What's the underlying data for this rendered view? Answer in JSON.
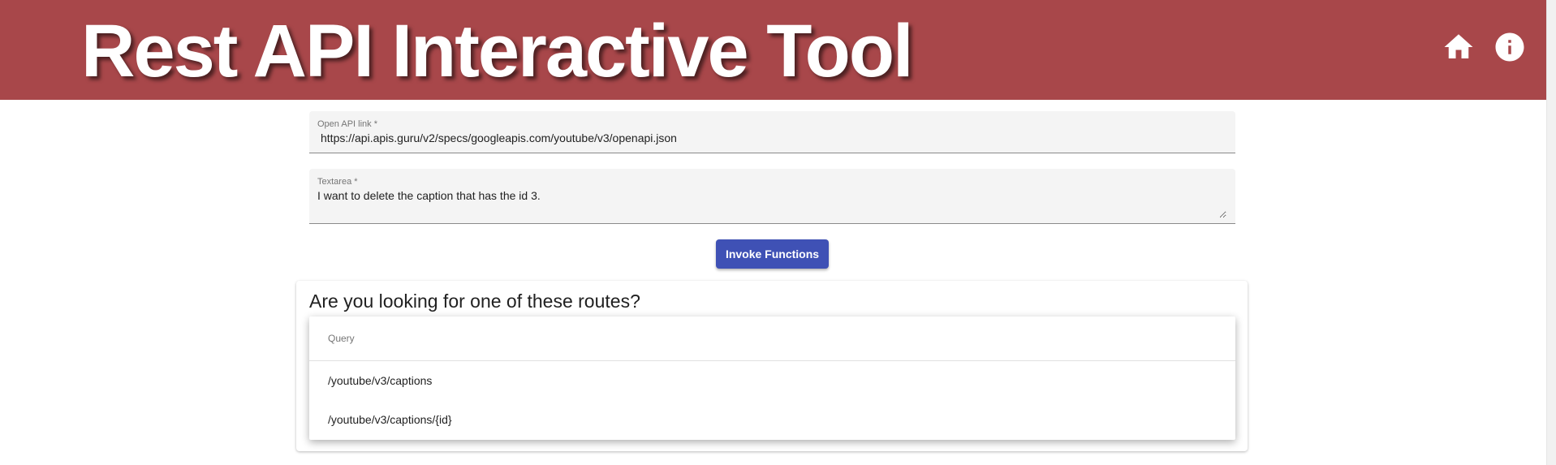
{
  "header": {
    "title": "Rest API Interactive Tool",
    "icons": [
      "home-icon",
      "info-icon"
    ],
    "background_color": "#a8474a"
  },
  "form": {
    "api_link_label": "Open API link *",
    "api_link_value": "https://api.apis.guru/v2/specs/googleapis.com/youtube/v3/openapi.json",
    "textarea_label": "Textarea *",
    "textarea_value": "I want to delete the caption that has the id 3.",
    "invoke_button_label": "Invoke Functions",
    "button_color": "#3f51b5"
  },
  "routes": {
    "title": "Are you looking for one of these routes?",
    "column_header": "Query",
    "rows": [
      "/youtube/v3/captions",
      "/youtube/v3/captions/{id}"
    ]
  }
}
